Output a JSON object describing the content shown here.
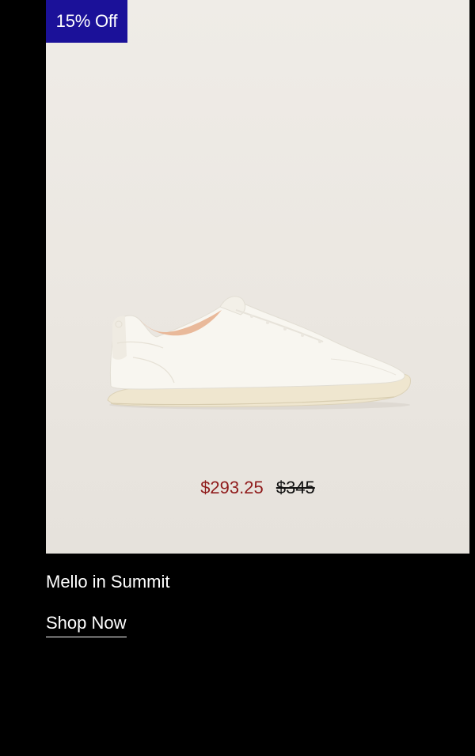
{
  "badge": {
    "label": "15% Off",
    "color": "#1b1199"
  },
  "product": {
    "image_icon": "sneaker-image",
    "sale_price": "$293.25",
    "original_price": "$345",
    "sale_price_color": "#8f1a1a",
    "name": "Mello in Summit"
  },
  "cta": {
    "label": "Shop Now"
  }
}
